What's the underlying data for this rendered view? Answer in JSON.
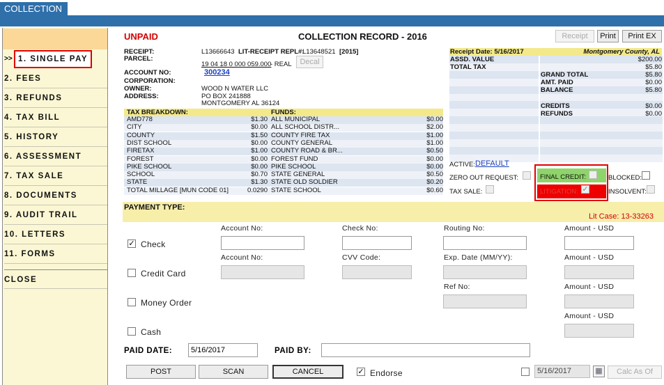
{
  "tab": "COLLECTION",
  "nav": {
    "arrow": ">>",
    "items": [
      "1. SINGLE PAY",
      "2. FEES",
      "3. REFUNDS",
      "4. TAX BILL",
      "5. HISTORY",
      "6. ASSESSMENT",
      "7. TAX SALE",
      "8. DOCUMENTS",
      "9. AUDIT TRAIL",
      "10. LETTERS",
      "11. FORMS",
      "CLOSE"
    ]
  },
  "header": {
    "status": "UNPAID",
    "title": "COLLECTION RECORD - 2016",
    "receipt_btn": "Receipt",
    "print_btn": "Print",
    "printex_btn": "Print EX"
  },
  "record": {
    "receipt_label": "RECEIPT:",
    "receipt": "L13666643",
    "lit_label": "LIT-RECEIPT REPL#:",
    "lit": "L13648521",
    "lit_year": "[2015]",
    "parcel_label": "PARCEL:",
    "parcel": "19 04 18 0 000 059.000",
    "parcel_type": "- REAL",
    "decal_btn": "Decal",
    "account_label": "ACCOUNT NO:",
    "account": "300234",
    "corp_label": "CORPORATION:",
    "owner_label": "OWNER:",
    "owner": "WOOD N WATER LLC",
    "address_label": "ADDRESS:",
    "address1": "PO BOX 241888",
    "address2": "MONTGOMERY AL  36124"
  },
  "tax_breakdown": {
    "header": "TAX BREAKDOWN:",
    "rows": [
      [
        "AMD778",
        "$1.30"
      ],
      [
        "CITY",
        "$0.00"
      ],
      [
        "COUNTY",
        "$1.50"
      ],
      [
        "DIST SCHOOL",
        "$0.00"
      ],
      [
        "FIRETAX",
        "$1.00"
      ],
      [
        "FOREST",
        "$0.00"
      ],
      [
        "PIKE SCHOOL",
        "$0.00"
      ],
      [
        "SCHOOL",
        "$0.70"
      ],
      [
        "STATE",
        "$1.30"
      ]
    ],
    "millage_label": "TOTAL MILLAGE [MUN CODE 01]",
    "millage": "0.0290"
  },
  "funds": {
    "header": "FUNDS:",
    "rows": [
      [
        "ALL MUNICIPAL",
        "$0.00"
      ],
      [
        "ALL SCHOOL DISTR...",
        "$2.00"
      ],
      [
        "COUNTY FIRE TAX",
        "$1.00"
      ],
      [
        "COUNTY GENERAL",
        "$1.00"
      ],
      [
        "COUNTY ROAD & BR...",
        "$0.50"
      ],
      [
        "FOREST FUND",
        "$0.00"
      ],
      [
        "PIKE SCHOOL",
        "$0.00"
      ],
      [
        "STATE GENERAL",
        "$0.50"
      ],
      [
        "STATE OLD SOLDIER",
        "$0.20"
      ],
      [
        "STATE SCHOOL",
        "$0.60"
      ]
    ]
  },
  "summary": {
    "receipt_date": "Receipt Date: 5/16/2017",
    "county": "Montgomery County, AL",
    "assd_label": "ASSD. VALUE",
    "assd": "$200.00",
    "total_tax_label": "TOTAL TAX",
    "total_tax": "$5.80",
    "grand_total_label": "GRAND TOTAL",
    "grand_total": "$5.80",
    "amt_paid_label": "AMT. PAID",
    "amt_paid": "$0.00",
    "balance_label": "BALANCE",
    "balance": "$5.80",
    "credits_label": "CREDITS",
    "credits": "$0.00",
    "refunds_label": "REFUNDS",
    "refunds": "$0.00"
  },
  "flags": {
    "active_label": "ACTIVE:",
    "active": "DEFAULT",
    "zero_out": "ZERO OUT REQUEST:",
    "final_credit": "FINAL CREDIT:",
    "blocked": "BLOCKED:",
    "tax_sale": "TAX SALE:",
    "litigation": "LITIGATION:",
    "insolvent": "INSOLVENT:",
    "litigation_checked": true
  },
  "payment": {
    "header": "PAYMENT TYPE:",
    "lit_case": "Lit Case: 13-33263",
    "check": {
      "label": "Check",
      "checked": true,
      "account_label": "Account No:",
      "check_label": "Check No:",
      "routing_label": "Routing No:",
      "amount_label": "Amount - USD"
    },
    "credit": {
      "label": "Credit Card",
      "account_label": "Account No:",
      "cvv_label": "CVV Code:",
      "exp_label": "Exp. Date (MM/YY):",
      "amount_label": "Amount - USD"
    },
    "money_order": {
      "label": "Money Order",
      "ref_label": "Ref No:",
      "amount_label": "Amount - USD"
    },
    "cash": {
      "label": "Cash",
      "amount_label": "Amount - USD"
    },
    "paid_date_label": "PAID DATE:",
    "paid_date": "5/16/2017",
    "paid_by_label": "PAID BY:",
    "paid_by": "",
    "post": "POST",
    "scan": "SCAN",
    "cancel": "CANCEL",
    "endorse": "Endorse",
    "endorse_checked": true,
    "calc_date": "5/16/2017",
    "calc_btn": "Calc As Of"
  }
}
